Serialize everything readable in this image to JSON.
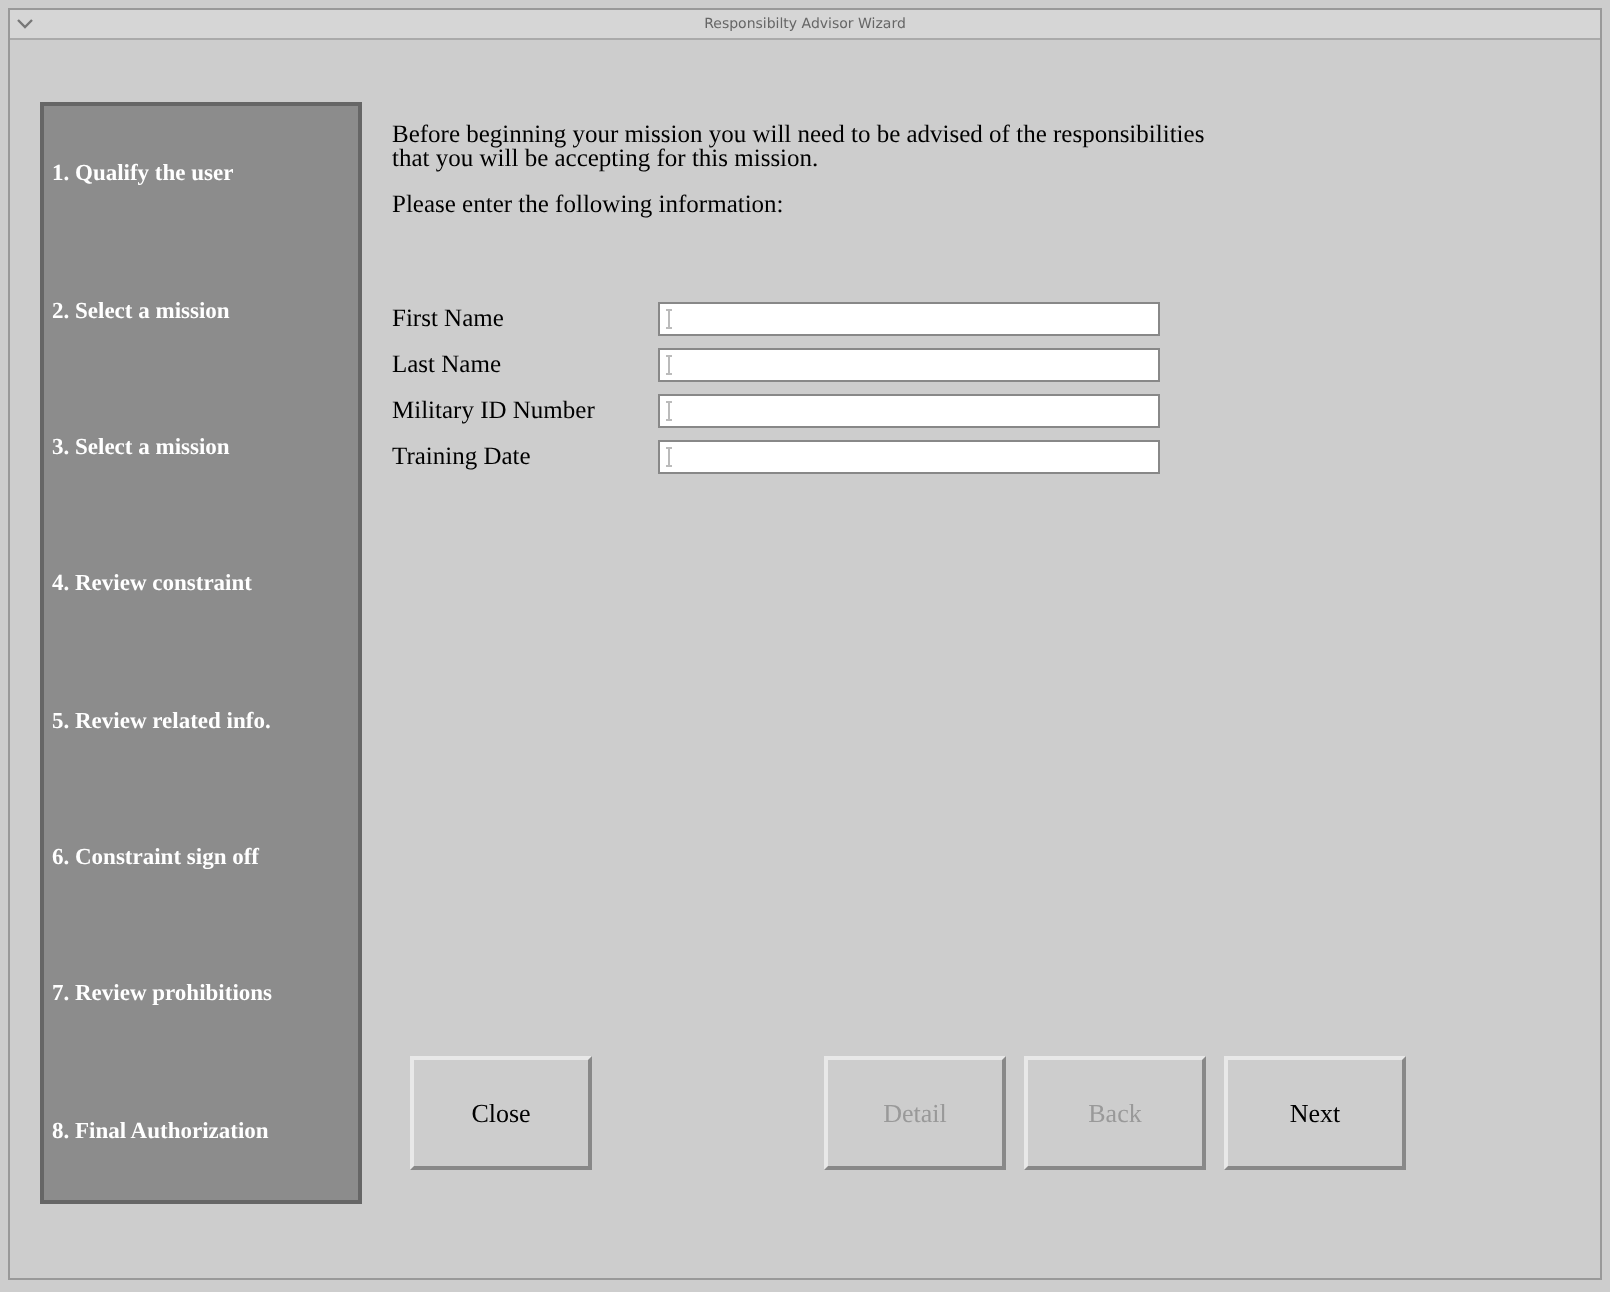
{
  "window": {
    "title": "Responsibilty Advisor Wizard"
  },
  "steps": [
    "1. Qualify the user",
    "2. Select a mission",
    "3. Select a mission",
    "4. Review constraint",
    "5. Review related info.",
    "6. Constraint sign off",
    "7. Review prohibitions",
    "8. Final Authorization"
  ],
  "intro": "Before beginning your mission you will need to be advised of the responsibilities that you will be accepting for this mission.",
  "prompt": "Please enter the following information:",
  "fields": [
    {
      "label": "First Name"
    },
    {
      "label": "Last Name"
    },
    {
      "label": "Military ID Number"
    },
    {
      "label": "Training Date"
    }
  ],
  "buttons": [
    {
      "label": "Close",
      "disabled": false
    },
    {
      "label": "Detail",
      "disabled": true
    },
    {
      "label": "Back",
      "disabled": true
    },
    {
      "label": "Next",
      "disabled": false
    }
  ]
}
